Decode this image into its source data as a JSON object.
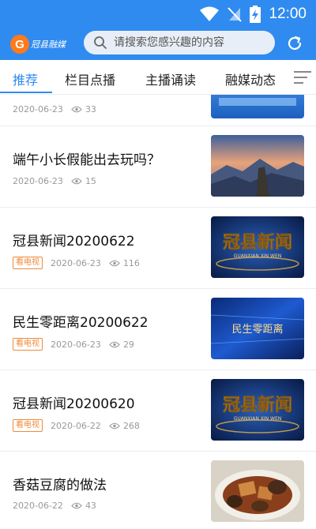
{
  "status_bar": {
    "time": "12:00"
  },
  "header": {
    "logo_letter": "G",
    "logo_text": "冠县融媒",
    "search_placeholder": "请搜索您感兴趣的内容"
  },
  "tabs": [
    {
      "label": "推荐",
      "active": true
    },
    {
      "label": "栏目点播",
      "active": false
    },
    {
      "label": "主播诵读",
      "active": false
    },
    {
      "label": "融媒动态",
      "active": false
    }
  ],
  "items": [
    {
      "title": "",
      "badge": "",
      "date": "2020-06-23",
      "views": "33"
    },
    {
      "title": "端午小长假能出去玩吗？",
      "badge": "",
      "date": "2020-06-23",
      "views": "15"
    },
    {
      "title": "冠县新闻20200622",
      "badge": "看电视",
      "date": "2020-06-23",
      "views": "116"
    },
    {
      "title": "民生零距离20200622",
      "badge": "看电视",
      "date": "2020-06-23",
      "views": "29"
    },
    {
      "title": "冠县新闻20200620",
      "badge": "看电视",
      "date": "2020-06-22",
      "views": "268"
    },
    {
      "title": "香菇豆腐的做法",
      "badge": "",
      "date": "2020-06-22",
      "views": "43"
    }
  ],
  "thumb_texts": {
    "news_title": "冠县新闻",
    "news_pinyin": "GUANXIAN XIN WEN",
    "minsheng_title": "民生零距离"
  },
  "colors": {
    "brand": "#2f8bf0",
    "badge": "#f08a3a",
    "logo": "#ff7a1a"
  }
}
